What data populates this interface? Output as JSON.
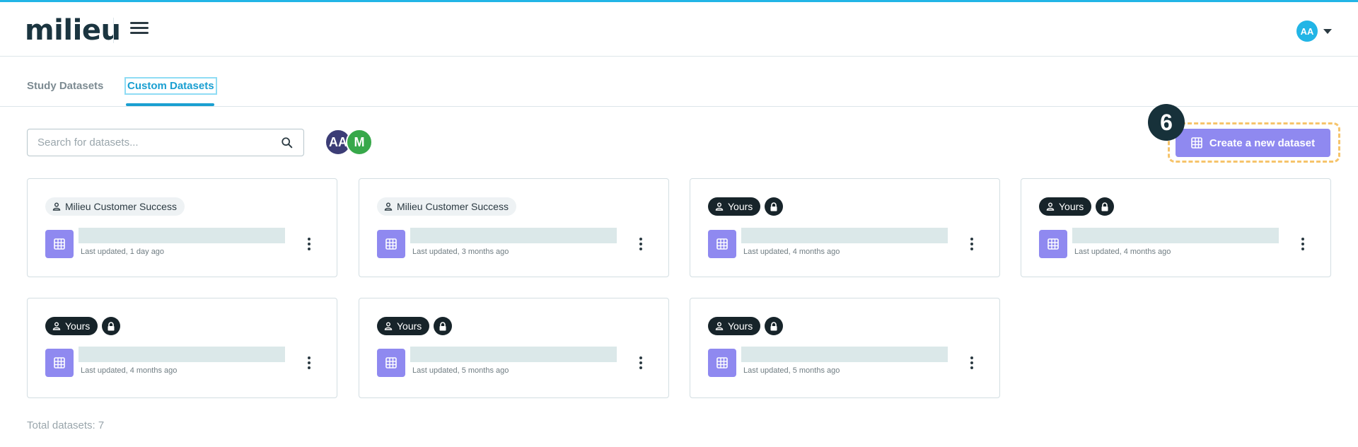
{
  "app": {
    "logo": "milieu"
  },
  "header": {
    "user_initials": "AA"
  },
  "tabs": [
    {
      "label": "Study Datasets",
      "active": false
    },
    {
      "label": "Custom Datasets",
      "active": true
    }
  ],
  "search": {
    "placeholder": "Search for datasets...",
    "value": ""
  },
  "filter_avatars": [
    "AA",
    "M"
  ],
  "create_button": {
    "label": "Create a new dataset"
  },
  "step_badge": "6",
  "cards": [
    {
      "owner": "Milieu Customer Success",
      "locked": false,
      "name": "",
      "updated": "Last updated, 1 day ago"
    },
    {
      "owner": "Milieu Customer Success",
      "locked": false,
      "name": "",
      "updated": "Last updated, 3 months ago"
    },
    {
      "owner": "Yours",
      "locked": true,
      "name": "",
      "updated": "Last updated, 4 months ago"
    },
    {
      "owner": "Yours",
      "locked": true,
      "name": "",
      "updated": "Last updated, 4 months ago"
    },
    {
      "owner": "Yours",
      "locked": true,
      "name": "",
      "updated": "Last updated, 4 months ago"
    },
    {
      "owner": "Yours",
      "locked": true,
      "name": "",
      "updated": "Last updated, 5 months ago"
    },
    {
      "owner": "Yours",
      "locked": true,
      "name": "",
      "updated": "Last updated, 5 months ago"
    }
  ],
  "footer": {
    "total": "Total datasets: 7"
  },
  "colors": {
    "accent": "#22b5e6",
    "primary_button": "#8f89f0",
    "highlight": "#f6c46b"
  }
}
